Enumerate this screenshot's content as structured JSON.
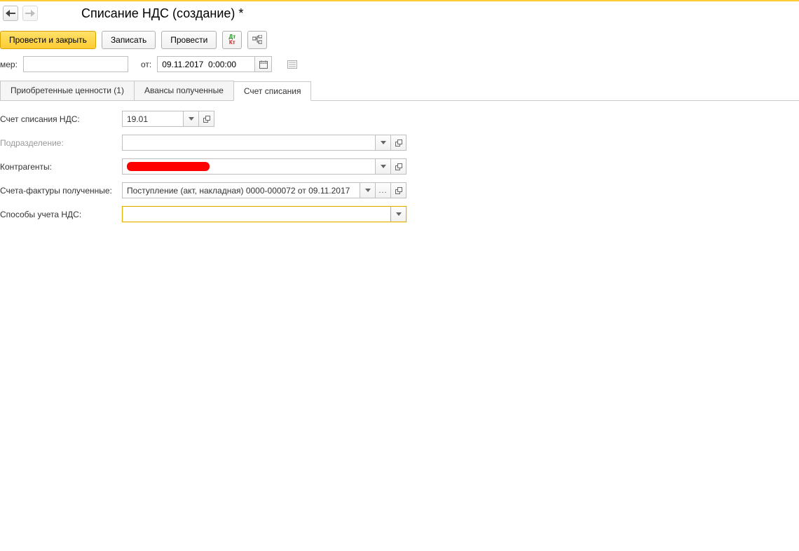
{
  "header": {
    "title": "Списание НДС (создание) *"
  },
  "toolbar": {
    "post_and_close": "Провести и закрыть",
    "write": "Записать",
    "post": "Провести"
  },
  "fields": {
    "number_label": "мер:",
    "number_value": "",
    "date_label": "от:",
    "date_value": "09.11.2017  0:00:00"
  },
  "tabs": [
    {
      "label": "Приобретенные ценности (1)"
    },
    {
      "label": "Авансы полученные"
    },
    {
      "label": "Счет списания"
    }
  ],
  "form": {
    "account_label": "Счет списания НДС:",
    "account_value": "19.01",
    "department_label": "Подразделение:",
    "department_value": "",
    "counterparty_label": "Контрагенты:",
    "invoice_label": "Счета-фактуры полученные:",
    "invoice_value": "Поступление (акт, накладная) 0000-000072 от 09.11.2017",
    "vat_method_label": "Способы учета НДС:",
    "vat_method_value": ""
  }
}
